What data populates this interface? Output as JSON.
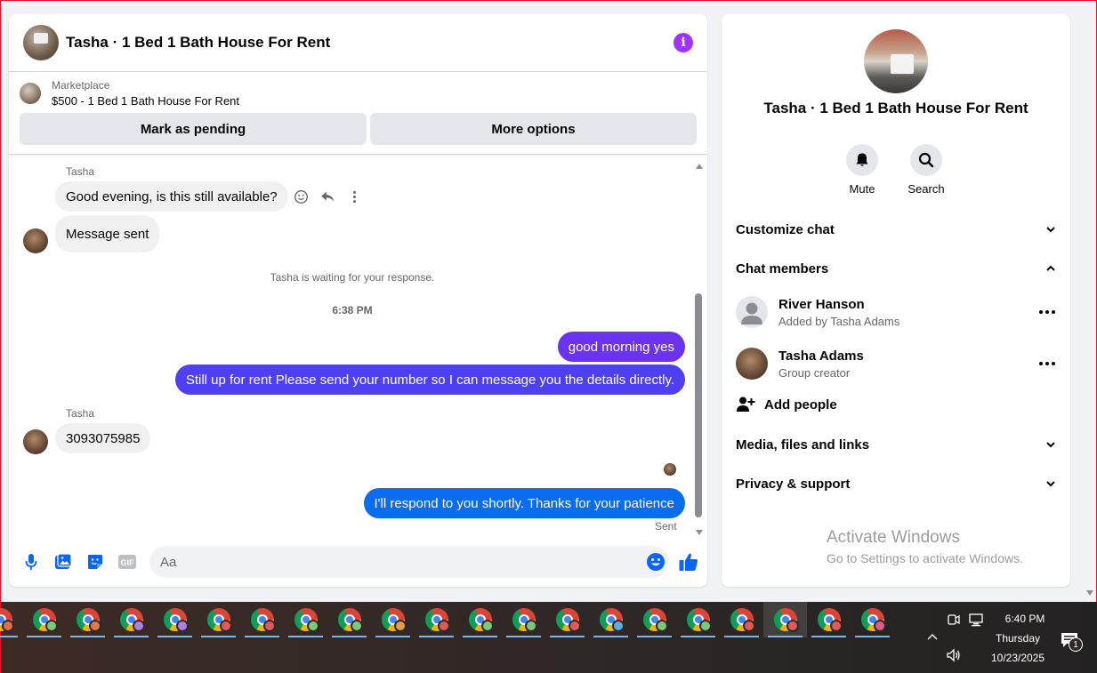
{
  "chat": {
    "title": "Tasha · 1 Bed 1 Bath House For Rent",
    "marketplace": {
      "label": "Marketplace",
      "listing": "$500 - 1 Bed 1 Bath House For Rent",
      "mark_pending_label": "Mark as pending",
      "more_options_label": "More options"
    },
    "messages": {
      "sender1": "Tasha",
      "in1": "Good evening, is this still available?",
      "in2": "Message sent",
      "system": "Tasha is waiting for your response.",
      "time": "6:38 PM",
      "out1": "good morning yes",
      "out2": "Still up for rent Please send your number so I can message you the details directly.",
      "sender2": "Tasha",
      "in3": "3093075985",
      "out3": "I'll respond to you shortly. Thanks for your patience",
      "status": "Sent"
    },
    "composer": {
      "placeholder": "Aa"
    },
    "colors": {
      "out_bubble_purple": "#5b3df5",
      "out_bubble_blue": "#0a7cff",
      "accent": "#0866ff",
      "info_purple": "#a033ff"
    }
  },
  "info_panel": {
    "title": "Tasha · 1 Bed 1 Bath House For Rent",
    "mute_label": "Mute",
    "search_label": "Search",
    "customize_chat": "Customize chat",
    "chat_members": "Chat members",
    "members": [
      {
        "name": "River Hanson",
        "sub": "Added by Tasha Adams"
      },
      {
        "name": "Tasha Adams",
        "sub": "Group creator"
      }
    ],
    "add_people": "Add people",
    "media": "Media, files and links",
    "privacy": "Privacy & support",
    "watermark_title": "Activate Windows",
    "watermark_sub": "Go to Settings to activate Windows."
  },
  "taskbar": {
    "time": "6:40 PM",
    "day": "Thursday",
    "date": "10/23/2025",
    "notification_count": "1",
    "app_badges": [
      "#e06c4a",
      "#7ec87a",
      "#e07a4a",
      "#b07ee0",
      "#b07ee0",
      "#e05a5a",
      "#e05a5a",
      "#7ec87a",
      "#7ec87a",
      "#e0a04a",
      "#e05a5a",
      "#7ec87a",
      "#7ec87a",
      "#e05a5a",
      "#5ab0e0",
      "#7ec87a",
      "#7ec87a",
      "#e05a5a",
      "#e05a5a",
      "#e05a5a",
      "#e05a8a"
    ]
  }
}
